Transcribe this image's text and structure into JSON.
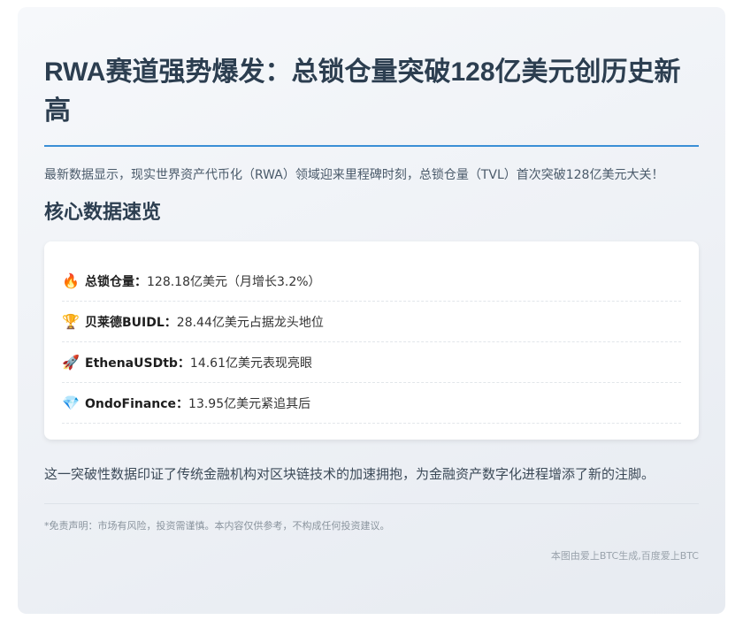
{
  "article": {
    "title": "RWA赛道强势爆发：总锁仓量突破128亿美元创历史新高",
    "intro": "最新数据显示，现实世界资产代币化（RWA）领域迎来里程碑时刻，总锁仓量（TVL）首次突破128亿美元大关！",
    "section_title": "核心数据速览",
    "stats": [
      {
        "icon": "🔥",
        "icon_name": "fire-icon",
        "label": "总锁仓量：",
        "value": "128.18亿美元（月增长3.2%）"
      },
      {
        "icon": "🏆",
        "icon_name": "trophy-icon",
        "label": "贝莱德BUIDL：",
        "value": "28.44亿美元占据龙头地位"
      },
      {
        "icon": "🚀",
        "icon_name": "rocket-icon",
        "label": "EthenaUSDtb：",
        "value": "14.61亿美元表现亮眼"
      },
      {
        "icon": "💎",
        "icon_name": "gem-icon",
        "label": "OndoFinance：",
        "value": "13.95亿美元紧追其后"
      }
    ],
    "summary": "这一突破性数据印证了传统金融机构对区块链技术的加速拥抱，为金融资产数字化进程增添了新的注脚。",
    "disclaimer": "*免责声明：市场有风险，投资需谨慎。本内容仅供参考，不构成任何投资建议。",
    "credit": "本图由爱上BTC生成,百度爱上BTC"
  },
  "colors": {
    "title": "#2c3e50",
    "accent_rule": "#3a8fd6"
  }
}
